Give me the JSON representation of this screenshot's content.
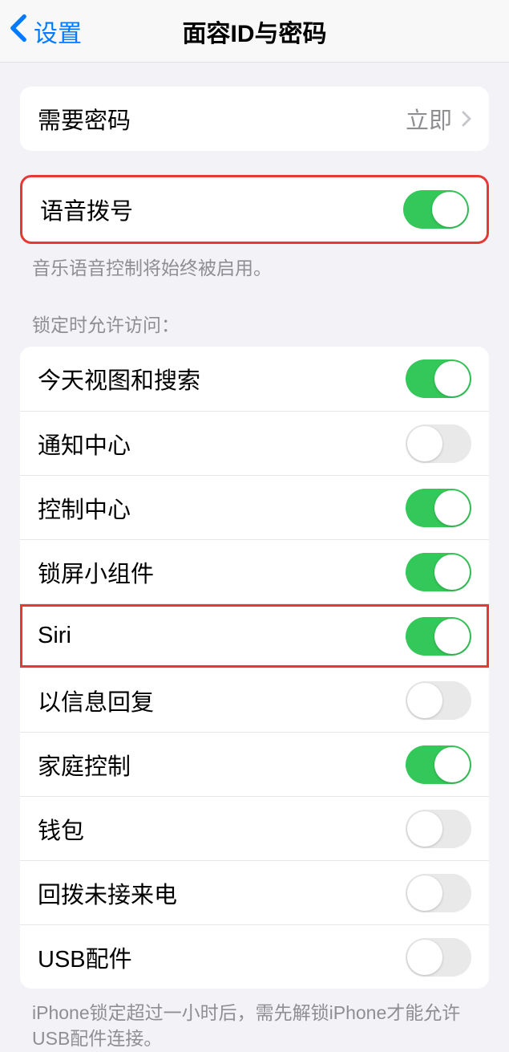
{
  "nav": {
    "back_label": "设置",
    "title": "面容ID与密码"
  },
  "passcode": {
    "label": "需要密码",
    "value": "立即"
  },
  "voicedial": {
    "label": "语音拨号",
    "footer": "音乐语音控制将始终被启用。"
  },
  "lock_access": {
    "header": "锁定时允许访问：",
    "items": [
      {
        "label": "今天视图和搜索",
        "on": true
      },
      {
        "label": "通知中心",
        "on": false
      },
      {
        "label": "控制中心",
        "on": true
      },
      {
        "label": "锁屏小组件",
        "on": true
      },
      {
        "label": "Siri",
        "on": true
      },
      {
        "label": "以信息回复",
        "on": false
      },
      {
        "label": "家庭控制",
        "on": true
      },
      {
        "label": "钱包",
        "on": false
      },
      {
        "label": "回拨未接来电",
        "on": false
      },
      {
        "label": "USB配件",
        "on": false
      }
    ],
    "footer": "iPhone锁定超过一小时后，需先解锁iPhone才能允许USB配件连接。"
  }
}
